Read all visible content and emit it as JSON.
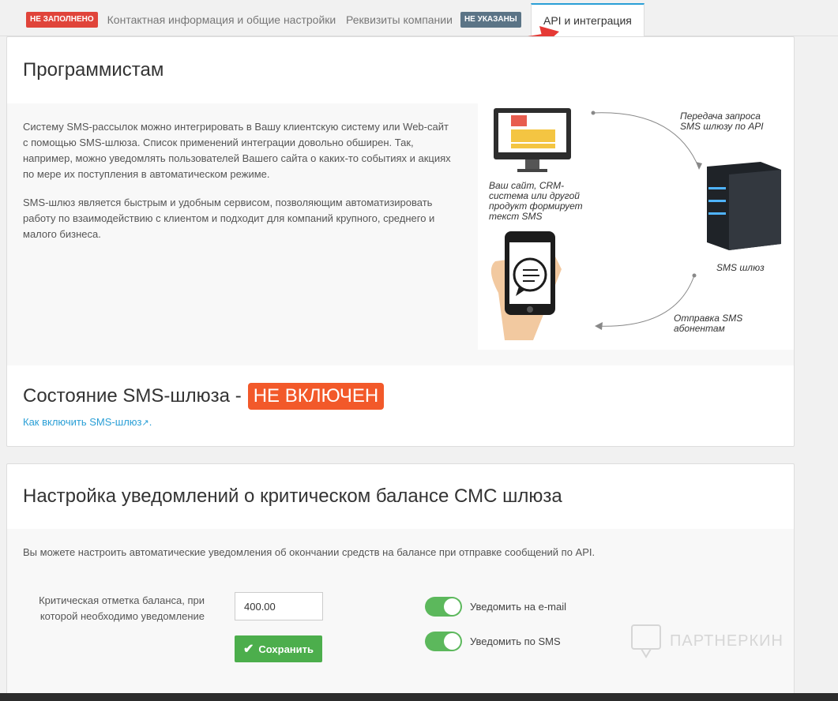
{
  "tabs": [
    {
      "badge": "НЕ ЗАПОЛНЕНО",
      "label": "Контактная информация и общие настройки"
    },
    {
      "label": "Реквизиты компании",
      "badge": "НЕ УКАЗАНЫ"
    },
    {
      "label": "API и интеграция"
    }
  ],
  "dev": {
    "title": "Программистам",
    "para1": "Систему SMS-рассылок можно интегрировать в Вашу клиентскую систему или Web-сайт с помощью SMS-шлюза. Список применений интеграции довольно обширен. Так, например, можно уведомлять пользователей Вашего сайта о каких-то событиях и акциях по мере их поступления в автоматическом режиме.",
    "para2": "SMS-шлюз является быстрым и удобным сервисом, позволяющим автоматизировать работу по взаимодействию с клиентом и подходит для компаний крупного, среднего и малого бизнеса.",
    "illustration": {
      "top_right": "Передача запроса SMS шлюзу по API",
      "left_mid": "Ваш сайт, CRM-система или другой продукт формирует текст SMS",
      "server": "SMS шлюз",
      "bottom": "Отправка SMS абонентам"
    },
    "status_prefix": "Состояние SMS-шлюза -",
    "status_badge": "НЕ ВКЛЮЧЕН",
    "howto_link": "Как включить SMS-шлюз"
  },
  "balance": {
    "title": "Настройка уведомлений о критическом балансе СМС шлюза",
    "description": "Вы можете настроить автоматические уведомления об окончании средств на балансе при отправке сообщений по API.",
    "threshold_label": "Критическая отметка баланса, при которой необходимо уведомление",
    "threshold_value": "400.00",
    "save_label": "Сохранить",
    "email_toggle_label": "Уведомить на e-mail",
    "email_toggle_on": true,
    "sms_toggle_label": "Уведомить по SMS",
    "sms_toggle_on": true
  },
  "watermark": "ПАРТНЕРКИН",
  "colors": {
    "accent": "#2a9fd6",
    "danger": "#e0443a",
    "status": "#f2592a",
    "success": "#5cb85c",
    "arrow": "#e53935"
  }
}
